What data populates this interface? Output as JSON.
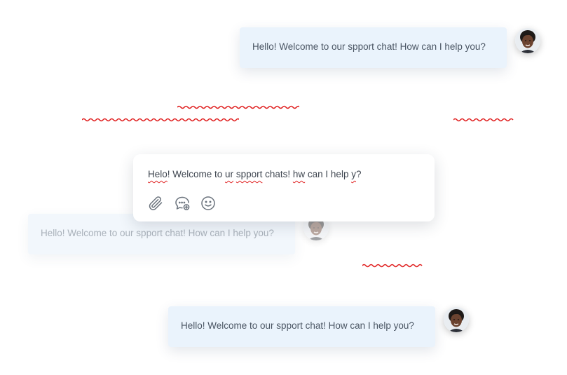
{
  "messages": [
    {
      "text": "Hello! Welcome to our spport chat! How can I help you?"
    },
    {
      "text": "Hello! Welcome to our spport chat! How can I help you?"
    },
    {
      "text": "Hello! Welcome to our spport chat! How can I help you?"
    }
  ],
  "composer": {
    "segments": [
      {
        "text": "Helo",
        "misspelled": true
      },
      {
        "text": "! Welcome to ",
        "misspelled": false
      },
      {
        "text": "ur",
        "misspelled": true
      },
      {
        "text": " ",
        "misspelled": false
      },
      {
        "text": "spport",
        "misspelled": true
      },
      {
        "text": " chats! ",
        "misspelled": false
      },
      {
        "text": "hw",
        "misspelled": true
      },
      {
        "text": " can I help ",
        "misspelled": false
      },
      {
        "text": "y",
        "misspelled": true
      },
      {
        "text": "?",
        "misspelled": false
      }
    ],
    "tools": [
      "paperclip-icon",
      "chat-add-icon",
      "smiley-icon"
    ]
  },
  "colors": {
    "bubble": "#eaf3fc",
    "spellcheck": "#e02020",
    "text": "#4a5563"
  }
}
